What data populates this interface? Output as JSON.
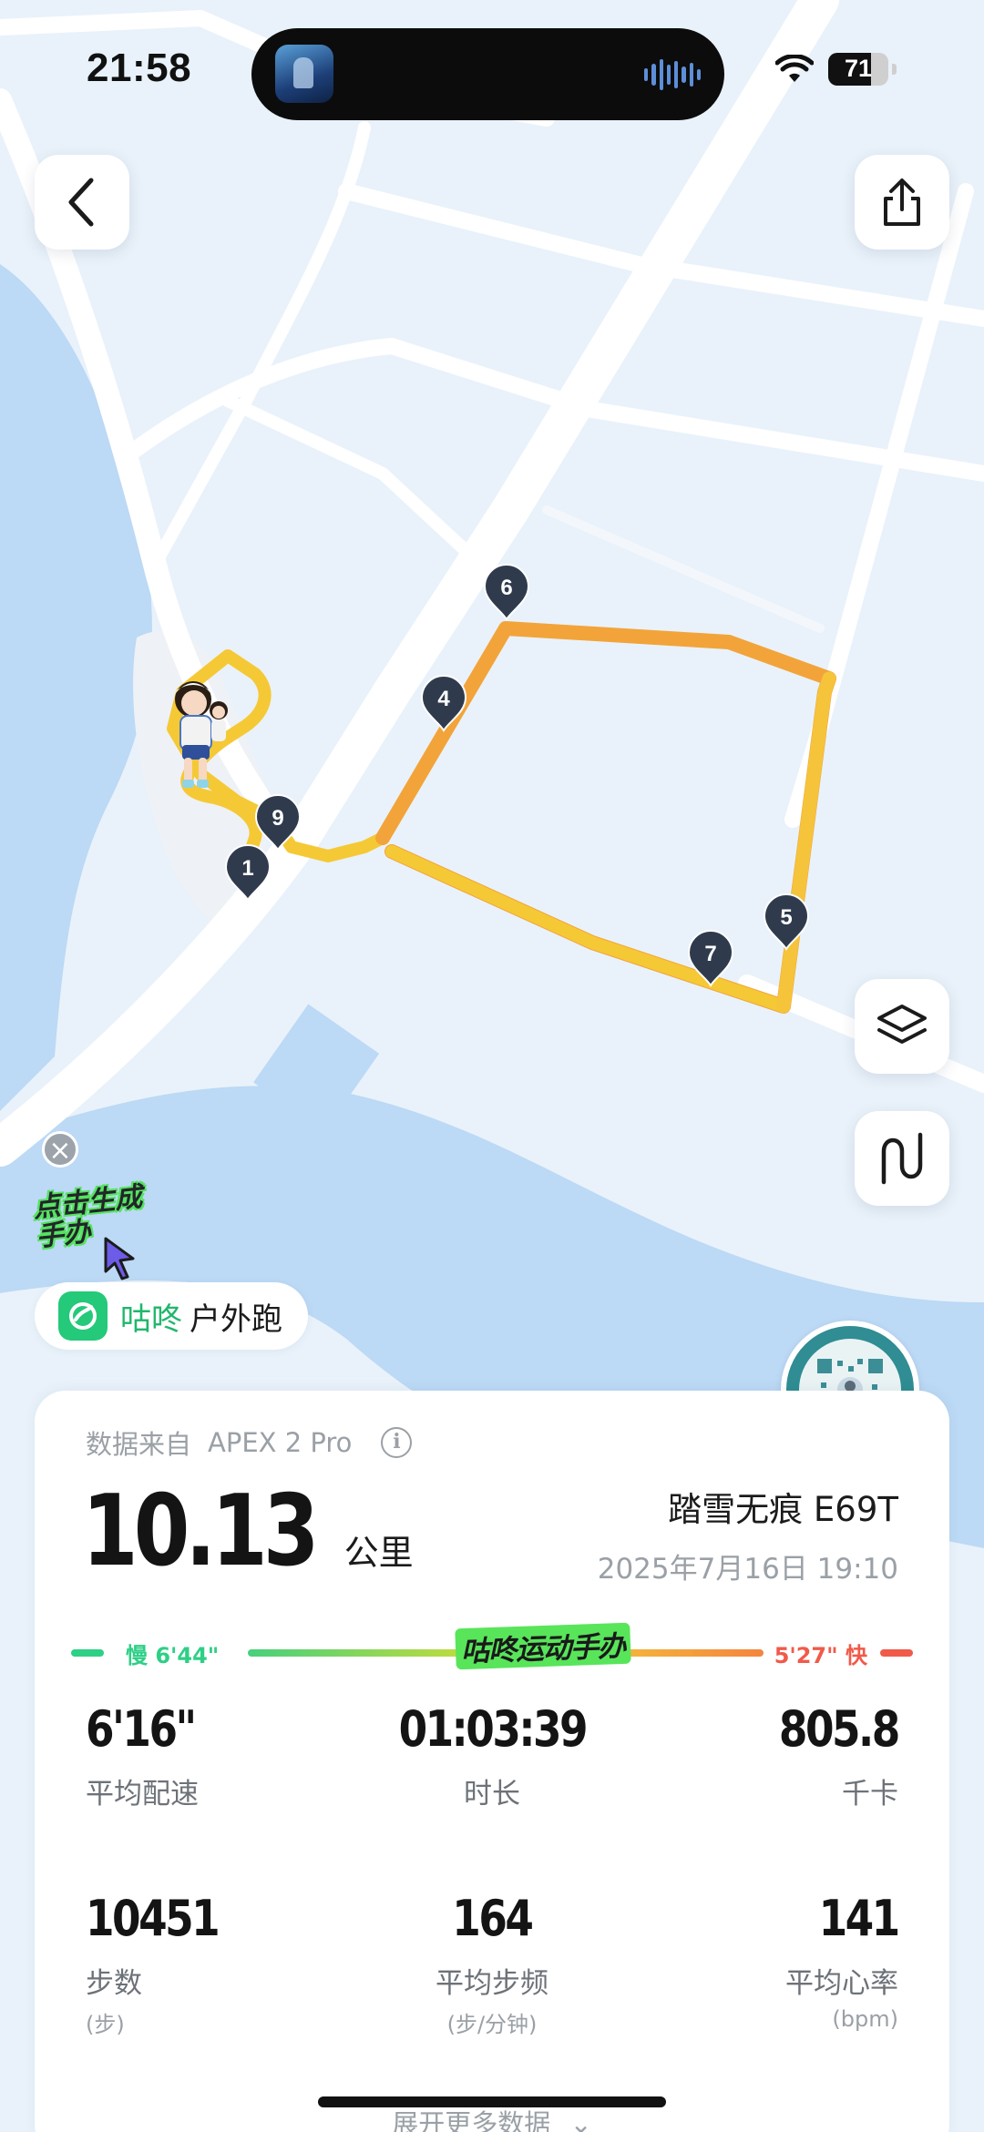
{
  "status_bar": {
    "time": "21:58",
    "battery": "71",
    "battery_level": 0.71
  },
  "map": {
    "pace_markers": [
      "1",
      "4",
      "5",
      "6",
      "7",
      "9"
    ],
    "route_colors": {
      "slow": "#f5c935",
      "fast": "#f2a43a"
    },
    "water_color": "#bcd9f5",
    "land_color": "#e9f2fa"
  },
  "ad": {
    "text": "点击生成手办"
  },
  "activity": {
    "brand": "咕咚",
    "type": "户外跑"
  },
  "card": {
    "source_label": "数据来自",
    "device": "APEX 2 Pro",
    "distance": "10.13",
    "distance_unit": "公里",
    "shoe": "踏雪无痕 E69T",
    "datetime": "2025年7月16日 19:10",
    "pace_bar": {
      "slow_label": "慢 6'44\"",
      "fast_label": "5'27\" 快",
      "sticker": "咕咚运动手办"
    },
    "stats": [
      {
        "value": "6'16\"",
        "label": "平均配速",
        "sub": ""
      },
      {
        "value": "01:03:39",
        "label": "时长",
        "sub": ""
      },
      {
        "value": "805.8",
        "label": "千卡",
        "sub": ""
      },
      {
        "value": "10451",
        "label": "步数",
        "sub": "(步)"
      },
      {
        "value": "164",
        "label": "平均步频",
        "sub": "(步/分钟)"
      },
      {
        "value": "141",
        "label": "平均心率",
        "sub": "(bpm)"
      }
    ],
    "expand_label": "展开更多数据"
  },
  "icons": {
    "back": "chevron-left-icon",
    "share": "share-icon",
    "layers": "layers-icon",
    "route": "route-icon",
    "info": "info-icon",
    "close": "close-icon",
    "expand": "chevron-down-icon"
  }
}
